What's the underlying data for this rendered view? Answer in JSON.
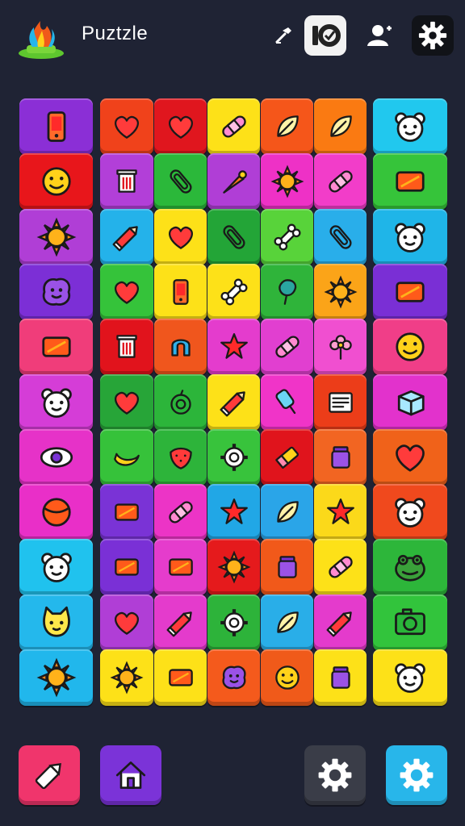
{
  "app": {
    "title": "Puztzle"
  },
  "header": {
    "buttons": [
      {
        "name": "hammer-icon",
        "style": "plain"
      },
      {
        "name": "level-badge-icon",
        "style": "white"
      },
      {
        "name": "profile-icon",
        "style": "plain"
      },
      {
        "name": "settings-gear-icon",
        "style": "dark"
      }
    ]
  },
  "board": {
    "rows": [
      [
        {
          "color": "#8b2fd6",
          "icon": "phone-icon"
        },
        {
          "color": "#f0421b",
          "icon": "heart-icon"
        },
        {
          "color": "#e0161e",
          "icon": "heart-icon"
        },
        {
          "color": "#fde118",
          "icon": "bandage-icon"
        },
        {
          "color": "#f5561a",
          "icon": "leaf-icon"
        },
        {
          "color": "#fa7a12",
          "icon": "leaf-icon"
        },
        {
          "color": "#21c8ee",
          "icon": "bear-face-icon"
        }
      ],
      [
        {
          "color": "#e8161b",
          "icon": "smiley-icon"
        },
        {
          "color": "#b23fd8",
          "icon": "trash-icon"
        },
        {
          "color": "#2bb83a",
          "icon": "paperclip-icon"
        },
        {
          "color": "#b03ed6",
          "icon": "carrot-icon"
        },
        {
          "color": "#ee31c6",
          "icon": "sun-icon"
        },
        {
          "color": "#f23dc9",
          "icon": "bandage-icon"
        },
        {
          "color": "#36c43a",
          "icon": "box-icon"
        }
      ],
      [
        {
          "color": "#b03ed6",
          "icon": "sun-icon"
        },
        {
          "color": "#24b2ea",
          "icon": "pencil-icon"
        },
        {
          "color": "#fde118",
          "icon": "heart-icon"
        },
        {
          "color": "#23a537",
          "icon": "paperclip-icon"
        },
        {
          "color": "#58d33a",
          "icon": "bone-icon"
        },
        {
          "color": "#29aeea",
          "icon": "paperclip-icon"
        },
        {
          "color": "#1fb5e8",
          "icon": "bear-face-icon"
        }
      ],
      [
        {
          "color": "#7c2fd6",
          "icon": "blob-face-icon"
        },
        {
          "color": "#35c33a",
          "icon": "heart-icon"
        },
        {
          "color": "#fde118",
          "icon": "phone-icon"
        },
        {
          "color": "#fde118",
          "icon": "bone-icon"
        },
        {
          "color": "#2fb43a",
          "icon": "balloon-icon"
        },
        {
          "color": "#fba418",
          "icon": "sun-icon"
        },
        {
          "color": "#7a2fd5",
          "icon": "box-icon"
        }
      ],
      [
        {
          "color": "#f03d7a",
          "icon": "box-icon"
        },
        {
          "color": "#e1131c",
          "icon": "trash-icon"
        },
        {
          "color": "#f0561d",
          "icon": "horseshoe-icon"
        },
        {
          "color": "#e43ccd",
          "icon": "star-icon"
        },
        {
          "color": "#e13fd0",
          "icon": "bandage-icon"
        },
        {
          "color": "#f04fd0",
          "icon": "flower-icon"
        },
        {
          "color": "#f03e88",
          "icon": "smiley-icon"
        }
      ],
      [
        {
          "color": "#d53dd7",
          "icon": "bear-face-icon"
        },
        {
          "color": "#27a538",
          "icon": "heart-icon"
        },
        {
          "color": "#2cb53a",
          "icon": "apple-icon"
        },
        {
          "color": "#fde118",
          "icon": "pencil-icon"
        },
        {
          "color": "#f034c8",
          "icon": "popsicle-icon"
        },
        {
          "color": "#ec3d19",
          "icon": "document-icon"
        },
        {
          "color": "#e232cc",
          "icon": "cube-icon"
        }
      ],
      [
        {
          "color": "#e632c8",
          "icon": "eye-icon"
        },
        {
          "color": "#36c23a",
          "icon": "banana-icon"
        },
        {
          "color": "#2db43a",
          "icon": "strawberry-icon"
        },
        {
          "color": "#38c33c",
          "icon": "gear-icon"
        },
        {
          "color": "#e0141c",
          "icon": "eraser-icon"
        },
        {
          "color": "#f26522",
          "icon": "jar-icon"
        },
        {
          "color": "#f0621a",
          "icon": "heart-icon"
        }
      ],
      [
        {
          "color": "#e92fc8",
          "icon": "ball-icon"
        },
        {
          "color": "#7a33d6",
          "icon": "box-icon"
        },
        {
          "color": "#ec34c6",
          "icon": "bandage-icon"
        },
        {
          "color": "#21a7e6",
          "icon": "star-icon"
        },
        {
          "color": "#2aa5e8",
          "icon": "leaf-icon"
        },
        {
          "color": "#fbd91a",
          "icon": "star-icon"
        },
        {
          "color": "#f0491d",
          "icon": "bear-face-icon"
        }
      ],
      [
        {
          "color": "#20c2ee",
          "icon": "bear-face-icon"
        },
        {
          "color": "#7a30d6",
          "icon": "box-icon"
        },
        {
          "color": "#e53ccc",
          "icon": "box-icon"
        },
        {
          "color": "#e51a1c",
          "icon": "sun-icon"
        },
        {
          "color": "#f1591a",
          "icon": "jar-icon"
        },
        {
          "color": "#fde118",
          "icon": "bandage-icon"
        },
        {
          "color": "#2db63a",
          "icon": "frog-face-icon"
        }
      ],
      [
        {
          "color": "#24b8ec",
          "icon": "cat-face-icon"
        },
        {
          "color": "#b03ed6",
          "icon": "heart-icon"
        },
        {
          "color": "#e43bcc",
          "icon": "pencil-icon"
        },
        {
          "color": "#2db33a",
          "icon": "gear-icon"
        },
        {
          "color": "#29aee8",
          "icon": "leaf-icon"
        },
        {
          "color": "#e43bcc",
          "icon": "pencil-icon"
        },
        {
          "color": "#32c43c",
          "icon": "camera-icon"
        }
      ],
      [
        {
          "color": "#21b7ec",
          "icon": "sun-icon"
        },
        {
          "color": "#fde118",
          "icon": "sun-icon"
        },
        {
          "color": "#fde118",
          "icon": "box-icon"
        },
        {
          "color": "#f45a1c",
          "icon": "blob-face-icon"
        },
        {
          "color": "#f05a1a",
          "icon": "smiley-icon"
        },
        {
          "color": "#fde118",
          "icon": "jar-icon"
        },
        {
          "color": "#fde118",
          "icon": "bear-face-icon"
        }
      ]
    ]
  },
  "footer": {
    "buttons": [
      {
        "name": "hint-button",
        "icon": "pencil-icon",
        "color": "#f0356c"
      },
      {
        "name": "home-button",
        "icon": "home-icon",
        "color": "#7b33d8"
      },
      {
        "name": "settings-button",
        "icon": "gear-icon",
        "color": "#3a3d48"
      },
      {
        "name": "options-button",
        "icon": "gear-icon",
        "color": "#28b6ea"
      }
    ]
  }
}
